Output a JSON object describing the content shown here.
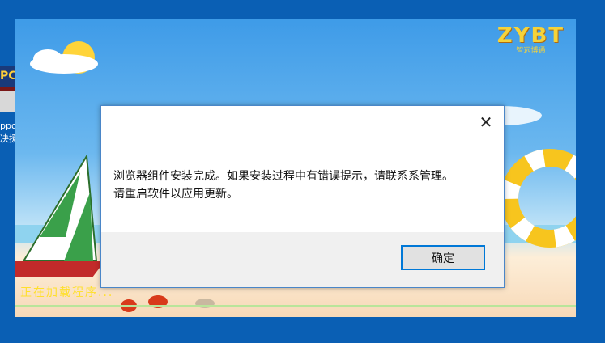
{
  "desktop_icon": {
    "thumb_text": "PC",
    "label_line1": "ppo",
    "label_line2": "决援"
  },
  "splash": {
    "logo_text": "ZYBT",
    "logo_subtext": "智远博通",
    "loading_text": "正在加载程序..."
  },
  "dialog": {
    "message_line1": "浏览器组件安装完成。如果安装过程中有错误提示，请联系系管理。",
    "message_line2": "请重启软件以应用更新。",
    "ok_label": "确定",
    "close_glyph": "✕"
  }
}
